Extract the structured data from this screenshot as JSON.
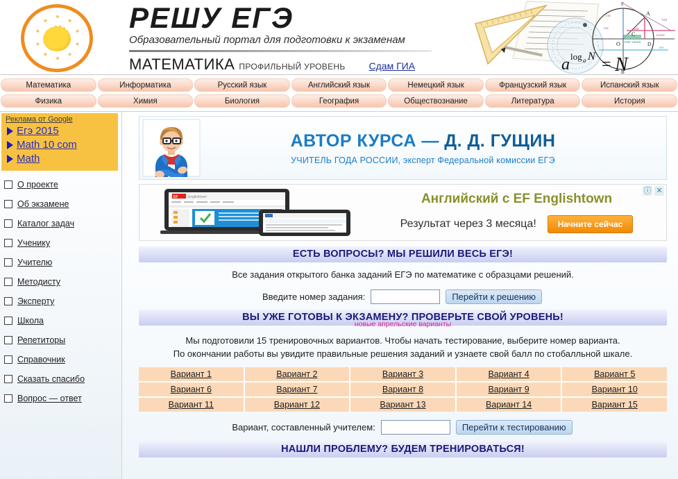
{
  "header": {
    "logo_icon": "sun-wheel-logo",
    "title": "РЕШУ ЕГЭ",
    "subtitle": "Образовательный портал для подготовки к экзаменам",
    "subject": "МАТЕМАТИКА",
    "level": "ПРОФИЛЬНЫЙ УРОВЕНЬ",
    "gia_link": "Сдам ГИА",
    "art_formula": "a log N = N",
    "art_icon": "math-instruments-illustration"
  },
  "nav": {
    "row1": [
      {
        "label": "Математика"
      },
      {
        "label": "Информатика"
      },
      {
        "label": "Русский язык"
      },
      {
        "label": "Английский язык"
      },
      {
        "label": "Немецкий язык"
      },
      {
        "label": "Французский язык"
      },
      {
        "label": "Испанский язык"
      }
    ],
    "row2": [
      {
        "label": "Физика"
      },
      {
        "label": "Химия"
      },
      {
        "label": "Биология"
      },
      {
        "label": "География"
      },
      {
        "label": "Обществознание"
      },
      {
        "label": "Литература"
      },
      {
        "label": "История"
      }
    ]
  },
  "sidebar": {
    "ads_title": "Реклама от Google",
    "ads": [
      {
        "label": "Егэ 2015"
      },
      {
        "label": "Math 10 com"
      },
      {
        "label": "Math"
      }
    ],
    "menu": [
      {
        "label": "О проекте"
      },
      {
        "label": "Об экзамене"
      },
      {
        "label": "Каталог задач"
      },
      {
        "label": "Ученику"
      },
      {
        "label": "Учителю"
      },
      {
        "label": "Методисту"
      },
      {
        "label": "Эксперту"
      },
      {
        "label": "Школа"
      },
      {
        "label": "Репетиторы"
      },
      {
        "label": "Справочник"
      },
      {
        "label": "Сказать спасибо"
      },
      {
        "label": "Вопрос — ответ"
      }
    ]
  },
  "author_banner": {
    "title_prefix": "АВТОР КУРСА — ",
    "title_name": "Д. Д. ГУЩИН",
    "subtitle": "УЧИТЕЛЬ ГОДА РОССИИ, эксперт Федеральной комиссии ЕГЭ",
    "avatar_icon": "teacher-avatar-icon"
  },
  "ad_banner": {
    "headline": "Английский с EF Englishtown",
    "subline": "Результат через 3 месяца!",
    "cta": "Начните сейчас",
    "info_icon": "ⓘ",
    "close_icon": "✕",
    "image_icon": "laptop-tablet-screenshot"
  },
  "section_questions": {
    "heading": "ЕСТЬ ВОПРОСЫ? МЫ РЕШИЛИ ВЕСЬ ЕГЭ!",
    "text": "Все задания открытого банка заданий ЕГЭ по математике с образцами решений.",
    "input_label": "Введите номер задания:",
    "input_value": "",
    "input_placeholder": "",
    "button": "Перейти к решению"
  },
  "section_level": {
    "heading": "ВЫ УЖЕ ГОТОВЫ К ЭКЗАМЕНУ? ПРОВЕРЬТЕ СВОЙ УРОВЕНЬ!",
    "note": "новые апрельские варианты",
    "text_line1": "Мы подготовили 15 тренировочных вариантов. Чтобы начать тестирование, выберите номер варианта.",
    "text_line2": "По окончании работы вы увидите правильные решения заданий и узнаете свой балл по стобалльной шкале.",
    "variants": [
      "Вариант 1",
      "Вариант 2",
      "Вариант 3",
      "Вариант 4",
      "Вариант 5",
      "Вариант 6",
      "Вариант 7",
      "Вариант 8",
      "Вариант 9",
      "Вариант 10",
      "Вариант 11",
      "Вариант 12",
      "Вариант 13",
      "Вариант 14",
      "Вариант 15"
    ],
    "teacher_label": "Вариант, составленный учителем:",
    "teacher_input_value": "",
    "teacher_button": "Перейти к тестированию"
  },
  "section_problem": {
    "heading": "НАШЛИ ПРОБЛЕМУ? БУДЕМ ТРЕНИРОВАТЬСЯ!"
  },
  "colors": {
    "tab": "#f6c6ae",
    "sidebar_ad": "#f7c242",
    "section_bar": "#c9cef0",
    "section_text": "#1a1a7a",
    "variant_cell": "#fbd9b8",
    "accent_blue": "#1b7cc4",
    "note_magenta": "#e0219b",
    "cta_orange": "#f08a06"
  }
}
